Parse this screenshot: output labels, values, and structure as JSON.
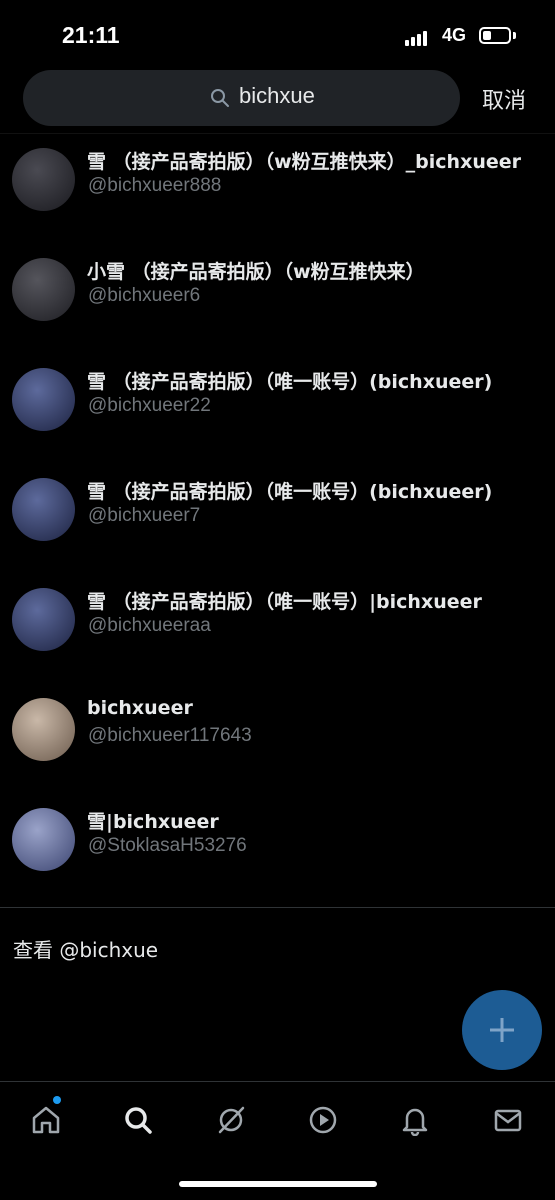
{
  "status_bar": {
    "time": "21:11",
    "network": "4G"
  },
  "search": {
    "query": "bichxue",
    "cancel_label": "取消"
  },
  "results": [
    {
      "name": "雪 （接产品寄拍版）（w粉互推快来）_bichxueer",
      "handle": "@bichxueer888",
      "avatar_colors": [
        "#4a4a52",
        "#1a1a1f"
      ]
    },
    {
      "name": "小雪 （接产品寄拍版）（w粉互推快来）",
      "handle": "@bichxueer6",
      "avatar_colors": [
        "#55555c",
        "#1d1d22"
      ]
    },
    {
      "name": "雪 （接产品寄拍版）（唯一账号）(bichxueer)",
      "handle": "@bichxueer22",
      "avatar_colors": [
        "#5d6a9c",
        "#1c2240"
      ]
    },
    {
      "name": "雪 （接产品寄拍版）（唯一账号）(bichxueer)",
      "handle": "@bichxueer7",
      "avatar_colors": [
        "#5d6a9c",
        "#1c2240"
      ]
    },
    {
      "name": "雪 （接产品寄拍版）（唯一账号）|bichxueer",
      "handle": "@bichxueeraa",
      "avatar_colors": [
        "#5d6a9c",
        "#1c2240"
      ]
    },
    {
      "name": "bichxueer",
      "handle": "@bichxueer117643",
      "avatar_colors": [
        "#c9b8a8",
        "#6b5a4c"
      ]
    },
    {
      "name": "雪|bichxueer",
      "handle": "@StoklasaH53276",
      "avatar_colors": [
        "#9aa3c9",
        "#3b4470"
      ]
    }
  ],
  "view_link": "查看 @bichxue",
  "tabbar": {
    "items": [
      "home-icon",
      "search-icon",
      "grok-icon",
      "video-icon",
      "notifications-icon",
      "messages-icon"
    ],
    "home_has_notification_dot": true
  },
  "colors": {
    "background": "#000000",
    "search_bg": "#202327",
    "fab": "#1d5c94",
    "accent": "#1d9bf0",
    "secondary_text": "#71767b"
  }
}
